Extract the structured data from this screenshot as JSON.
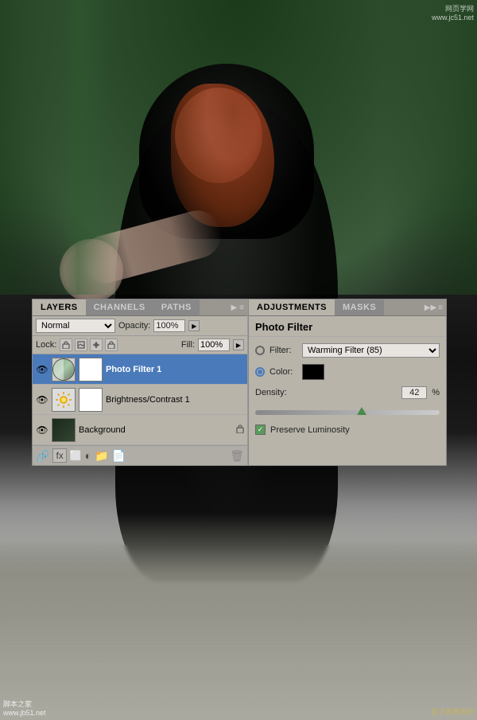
{
  "photo": {
    "alt": "Woman in black hooded cloak in forest"
  },
  "watermarks": {
    "top_right_line1": "网页学网",
    "top_right_line2": "www.jc51.net",
    "bottom_left_line1": "脚本之家",
    "bottom_left_line2": "www.jb51.net",
    "bottom_right": "查字典教程网"
  },
  "layers_panel": {
    "tabs": [
      "LAYERS",
      "CHANNELS",
      "PATHS"
    ],
    "active_tab": "LAYERS",
    "blend_mode": "Normal",
    "opacity_label": "Opacity:",
    "opacity_value": "100%",
    "lock_label": "Lock:",
    "fill_label": "Fill:",
    "fill_value": "100%",
    "layers": [
      {
        "name": "Photo Filter 1",
        "visible": true,
        "type": "adjustment",
        "active": true
      },
      {
        "name": "Brightness/Contrast 1",
        "visible": true,
        "type": "adjustment",
        "active": false
      },
      {
        "name": "Background",
        "visible": true,
        "type": "raster",
        "active": false,
        "locked": true
      }
    ]
  },
  "adjustments_panel": {
    "tabs": [
      "ADJUSTMENTS",
      "MASKS"
    ],
    "active_tab": "ADJUSTMENTS",
    "title": "Photo Filter",
    "filter_radio_label": "Filter:",
    "filter_value": "Warming Filter (85)",
    "color_radio_label": "Color:",
    "density_label": "Density:",
    "density_value": "42",
    "density_unit": "%",
    "preserve_luminosity_label": "Preserve Luminosity",
    "preserve_luminosity_checked": true
  }
}
